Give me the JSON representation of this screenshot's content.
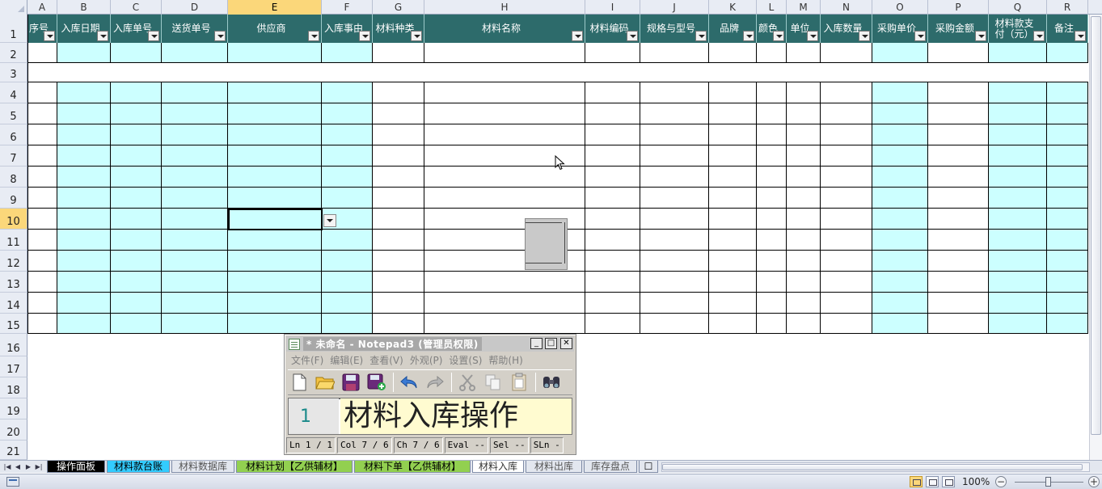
{
  "spreadsheet": {
    "columns": [
      "A",
      "B",
      "C",
      "D",
      "E",
      "F",
      "G",
      "H",
      "I",
      "J",
      "K",
      "L",
      "M",
      "N",
      "O",
      "P",
      "Q",
      "R"
    ],
    "active_column": "E",
    "rows": [
      "1",
      "2",
      "3",
      "4",
      "5",
      "6",
      "7",
      "8",
      "9",
      "10",
      "11",
      "12",
      "13",
      "14",
      "15",
      "16",
      "17",
      "18",
      "19",
      "20",
      "21"
    ],
    "active_row": "10",
    "header_row": [
      "序号",
      "入库日期",
      "入库单号",
      "送货单号",
      "供应商",
      "入库事由",
      "材料种类",
      "材料名称",
      "材料编码",
      "规格与型号",
      "品牌",
      "颜色",
      "单位",
      "入库数量",
      "采购单价",
      "采购金额",
      "材料款支付（元）",
      "备注"
    ],
    "colors": {
      "header_bg": "#2d6b6b",
      "header_text": "#ffffff",
      "cell_highlight": "#ccffff",
      "active_header": "#fbd77a"
    }
  },
  "notepad": {
    "title": "* 未命名 - Notepad3 (管理员权限)",
    "menu": [
      "文件(F)",
      "编辑(E)",
      "查看(V)",
      "外观(P)",
      "设置(S)",
      "帮助(H)"
    ],
    "toolbar_icons": [
      "new-file-icon",
      "open-folder-icon",
      "save-icon",
      "save-as-icon",
      "undo-icon",
      "redo-icon",
      "cut-icon",
      "copy-icon",
      "paste-icon",
      "find-icon"
    ],
    "line_number": "1",
    "content": "材料入库操作",
    "status": [
      "Ln  1 / 1",
      "Col  7 / 6",
      "Ch  7 / 6",
      "Eval  --",
      "Sel  --",
      "SLn  -"
    ]
  },
  "sheet_tabs": [
    {
      "label": "操作面板",
      "bg": "#000000",
      "fg": "#ffffff"
    },
    {
      "label": "材料款台账",
      "bg": "#33ccff",
      "fg": "#000000"
    },
    {
      "label": "材料数据库",
      "bg": "#e3e7ef",
      "fg": "#555555"
    },
    {
      "label": "材料计划【乙供辅材】",
      "bg": "#92d050",
      "fg": "#000000"
    },
    {
      "label": "材料下单【乙供辅材】",
      "bg": "#92d050",
      "fg": "#000000"
    },
    {
      "label": "材料入库",
      "bg": "#ffffff",
      "fg": "#333333"
    },
    {
      "label": "材料出库",
      "bg": "#e3e7ef",
      "fg": "#555555"
    },
    {
      "label": "库存盘点",
      "bg": "#e3e7ef",
      "fg": "#555555"
    }
  ],
  "statusbar": {
    "zoom": "100%"
  }
}
